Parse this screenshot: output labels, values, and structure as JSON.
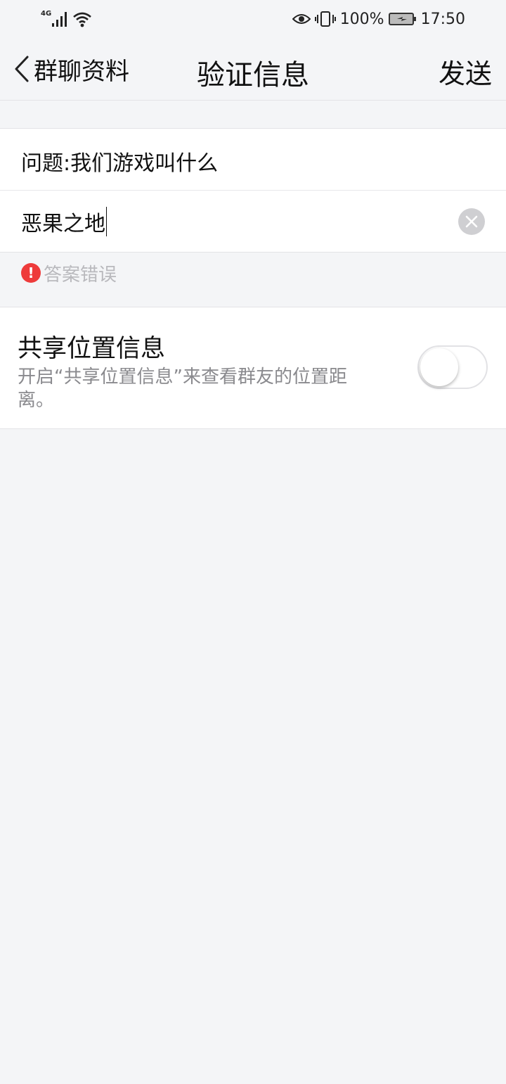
{
  "status_bar": {
    "network": "4G",
    "battery": "100%",
    "time": "17:50"
  },
  "nav": {
    "back_label": "群聊资料",
    "title": "验证信息",
    "send_label": "发送"
  },
  "form": {
    "question": "问题:我们游戏叫什么",
    "answer_value": "恶果之地",
    "error": "答案错误"
  },
  "location": {
    "title": "共享位置信息",
    "description": "开启“共享位置信息”来查看群友的位置距离。",
    "enabled": false
  },
  "colors": {
    "page_bg": "#f4f5f7",
    "card_bg": "#ffffff",
    "error_red": "#ee3b3b",
    "hint_gray": "#b9b9bd"
  }
}
